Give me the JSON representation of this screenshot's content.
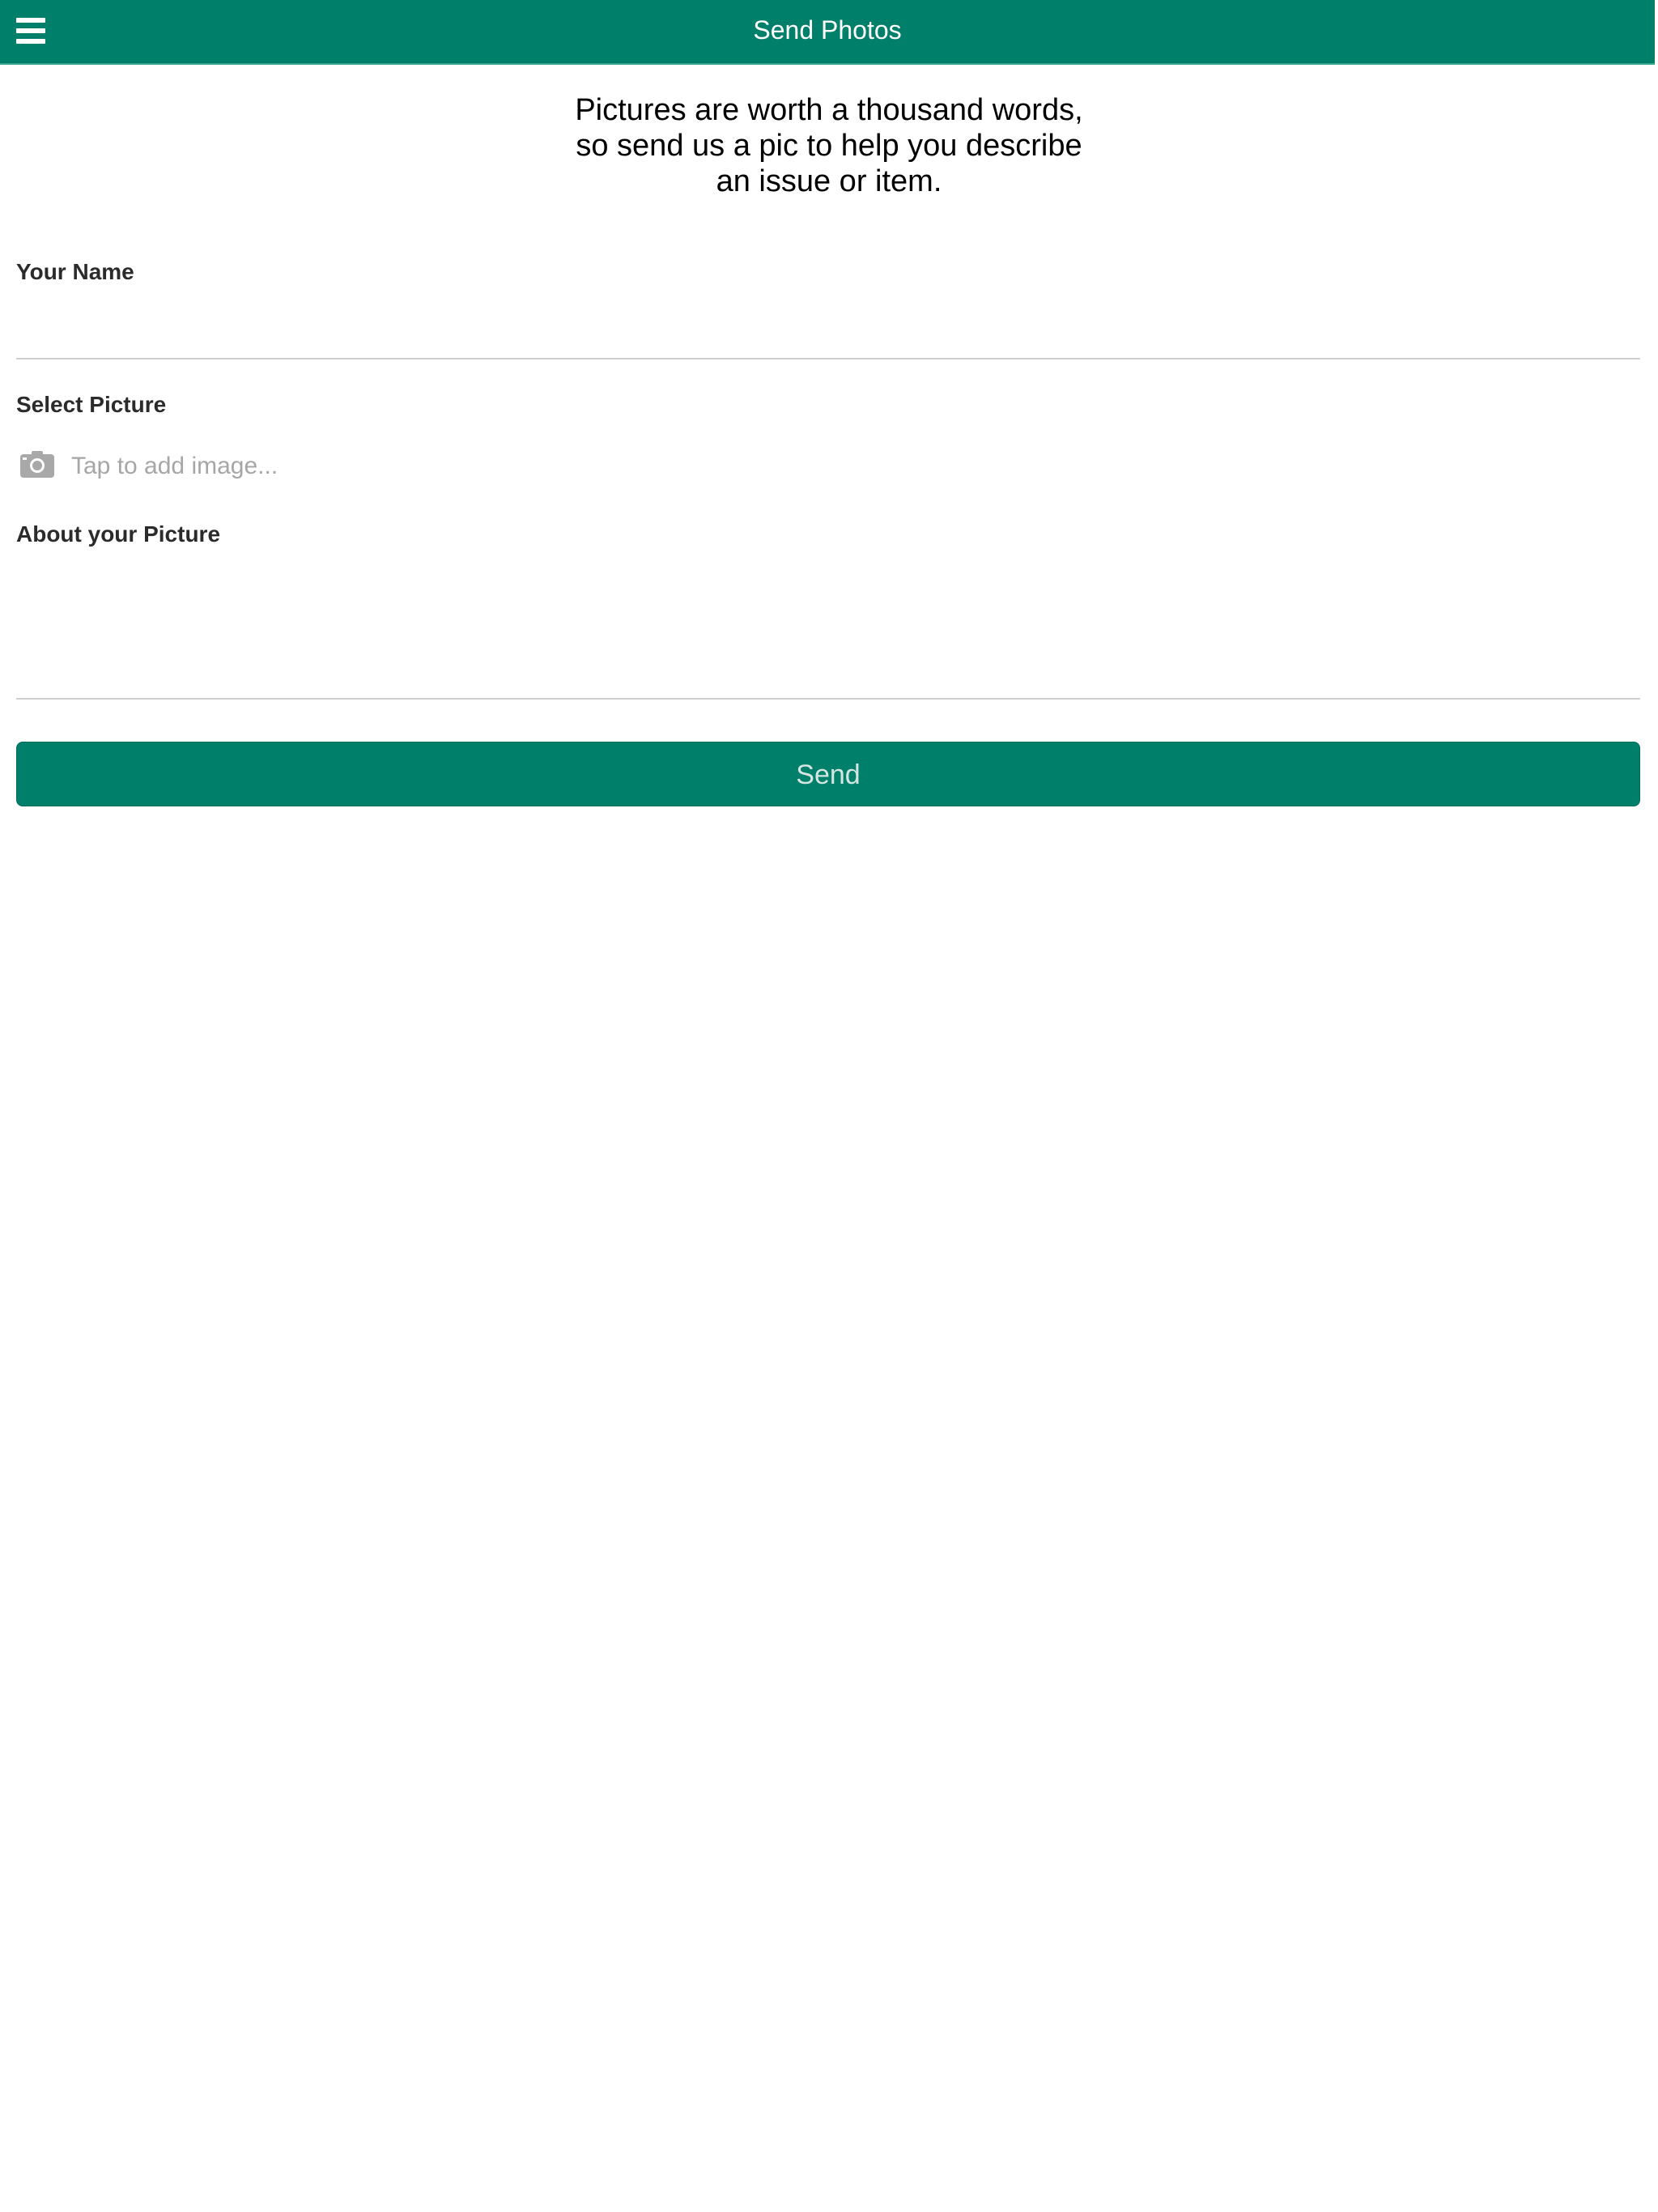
{
  "header": {
    "title": "Send Photos",
    "menu_icon": "hamburger-menu-icon",
    "background_color": "#007f6a"
  },
  "intro": {
    "text": "Pictures are worth a thousand words,\nso send us a pic to help you describe\nan issue or item."
  },
  "form": {
    "name_label": "Your Name",
    "name_value": "",
    "picture_label": "Select Picture",
    "picture_icon": "camera-icon",
    "picture_placeholder": "Tap to add image...",
    "about_label": "About your Picture",
    "about_value": ""
  },
  "actions": {
    "send_label": "Send",
    "send_color": "#007f6a"
  }
}
